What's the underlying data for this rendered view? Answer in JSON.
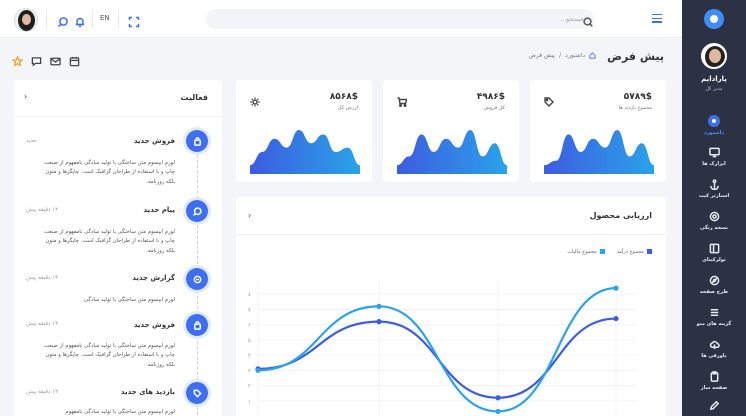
{
  "header": {
    "search_placeholder": "جستجو...",
    "lang": "EN"
  },
  "sidebar": {
    "user_name": "پارادایم",
    "user_role": "مدیر کل",
    "items": [
      {
        "label": "داشبورد",
        "icon": "dashboard-icon",
        "active": true
      },
      {
        "label": "ابزارک ها",
        "icon": "monitor-icon"
      },
      {
        "label": "استارتر کیت",
        "icon": "anchor-icon"
      },
      {
        "label": "نسخه رنگی",
        "icon": "target-icon"
      },
      {
        "label": "تولزکیتای",
        "icon": "layout-icon"
      },
      {
        "label": "طرح صفحه",
        "icon": "compass-icon"
      },
      {
        "label": "گزینه های منو",
        "icon": "menu-icon"
      },
      {
        "label": "پاورقی ها",
        "icon": "cloud-icon"
      },
      {
        "label": "صفحه ساز",
        "icon": "clipboard-icon"
      }
    ]
  },
  "page": {
    "title": "پیش فرض",
    "breadcrumb": [
      "داشبورد",
      "پیش فرض"
    ]
  },
  "stats": [
    {
      "value": "۵۷۸۹$",
      "label": "مجموع بازدید ها",
      "icon": "tag-icon",
      "series": [
        2,
        3,
        9,
        5,
        8,
        6,
        10,
        4,
        7,
        2
      ]
    },
    {
      "value": "۴۹۸۶$",
      "label": "کل فروش",
      "icon": "cart-icon",
      "series": [
        2,
        4,
        9,
        5,
        8,
        6,
        10,
        4,
        7,
        2
      ]
    },
    {
      "value": "۸۵۶۸$",
      "label": "ارزش کل",
      "icon": "sun-icon",
      "series": [
        2,
        5,
        8,
        6,
        10,
        7,
        9,
        5,
        6,
        2
      ]
    }
  ],
  "product_chart": {
    "title": "ارزیابی محصول",
    "more": "›",
    "legend": [
      {
        "name": "مجموع درآمد",
        "color": "#3d5ce0"
      },
      {
        "name": "مجموع مالیات",
        "color": "#2aa3e8"
      }
    ],
    "y_ticks": [
      "۸",
      "۷",
      "۶",
      "۵",
      "۴",
      "۳",
      "۲",
      "۱"
    ]
  },
  "chart_data": {
    "type": "line",
    "title": "ارزیابی محصول",
    "x": [
      1,
      2,
      3,
      4
    ],
    "series": [
      {
        "name": "مجموع درآمد",
        "color": "#3d5ce0",
        "values": [
          3.1,
          6.2,
          1.2,
          6.4
        ]
      },
      {
        "name": "مجموع مالیات",
        "color": "#2aa3e8",
        "values": [
          3.0,
          7.2,
          0.3,
          8.4
        ]
      }
    ],
    "ylim": [
      0,
      9
    ],
    "grid": true,
    "legend_position": "top-right"
  },
  "activity": {
    "title": "فعالیت",
    "more": "›",
    "items": [
      {
        "title": "فروش جدید",
        "time": "جدید",
        "icon": "bag-icon",
        "text": "لورم ایپسوم متن ساختگی با تولید سادگی نامفهوم از صنعت چاپ و با استفاده از طراحان گرافیک است. چاپگرها و متون بلکه روزنامه."
      },
      {
        "title": "پیام جدید",
        "time": "۱۴ دقیقه پیش",
        "icon": "message-icon",
        "text": "لورم ایپسوم متن ساختگی با تولید سادگی نامفهوم از صنعت چاپ و با استفاده از طراحان گرافیک است. چاپگرها و متون بلکه روزنامه."
      },
      {
        "title": "گزارش جدید",
        "time": "۱۴ دقیقه پیش",
        "icon": "minus-circle-icon",
        "text": "لورم ایپسوم متن ساختگی با تولید سادگی."
      },
      {
        "title": "فروش جدید",
        "time": "۱۴ دقیقه پیش",
        "icon": "bag-icon",
        "text": "لورم ایپسوم متن ساختگی با تولید سادگی نامفهوم از صنعت چاپ و با استفاده از طراحان گرافیک است. چاپگرها و متون بلکه روزنامه."
      },
      {
        "title": "بازدید های جدید",
        "time": "۱۴ دقیقه پیش",
        "icon": "tag-icon",
        "text": "لورم ایپسوم متن ساختگی با تولید سادگی نامفهوم"
      }
    ]
  }
}
